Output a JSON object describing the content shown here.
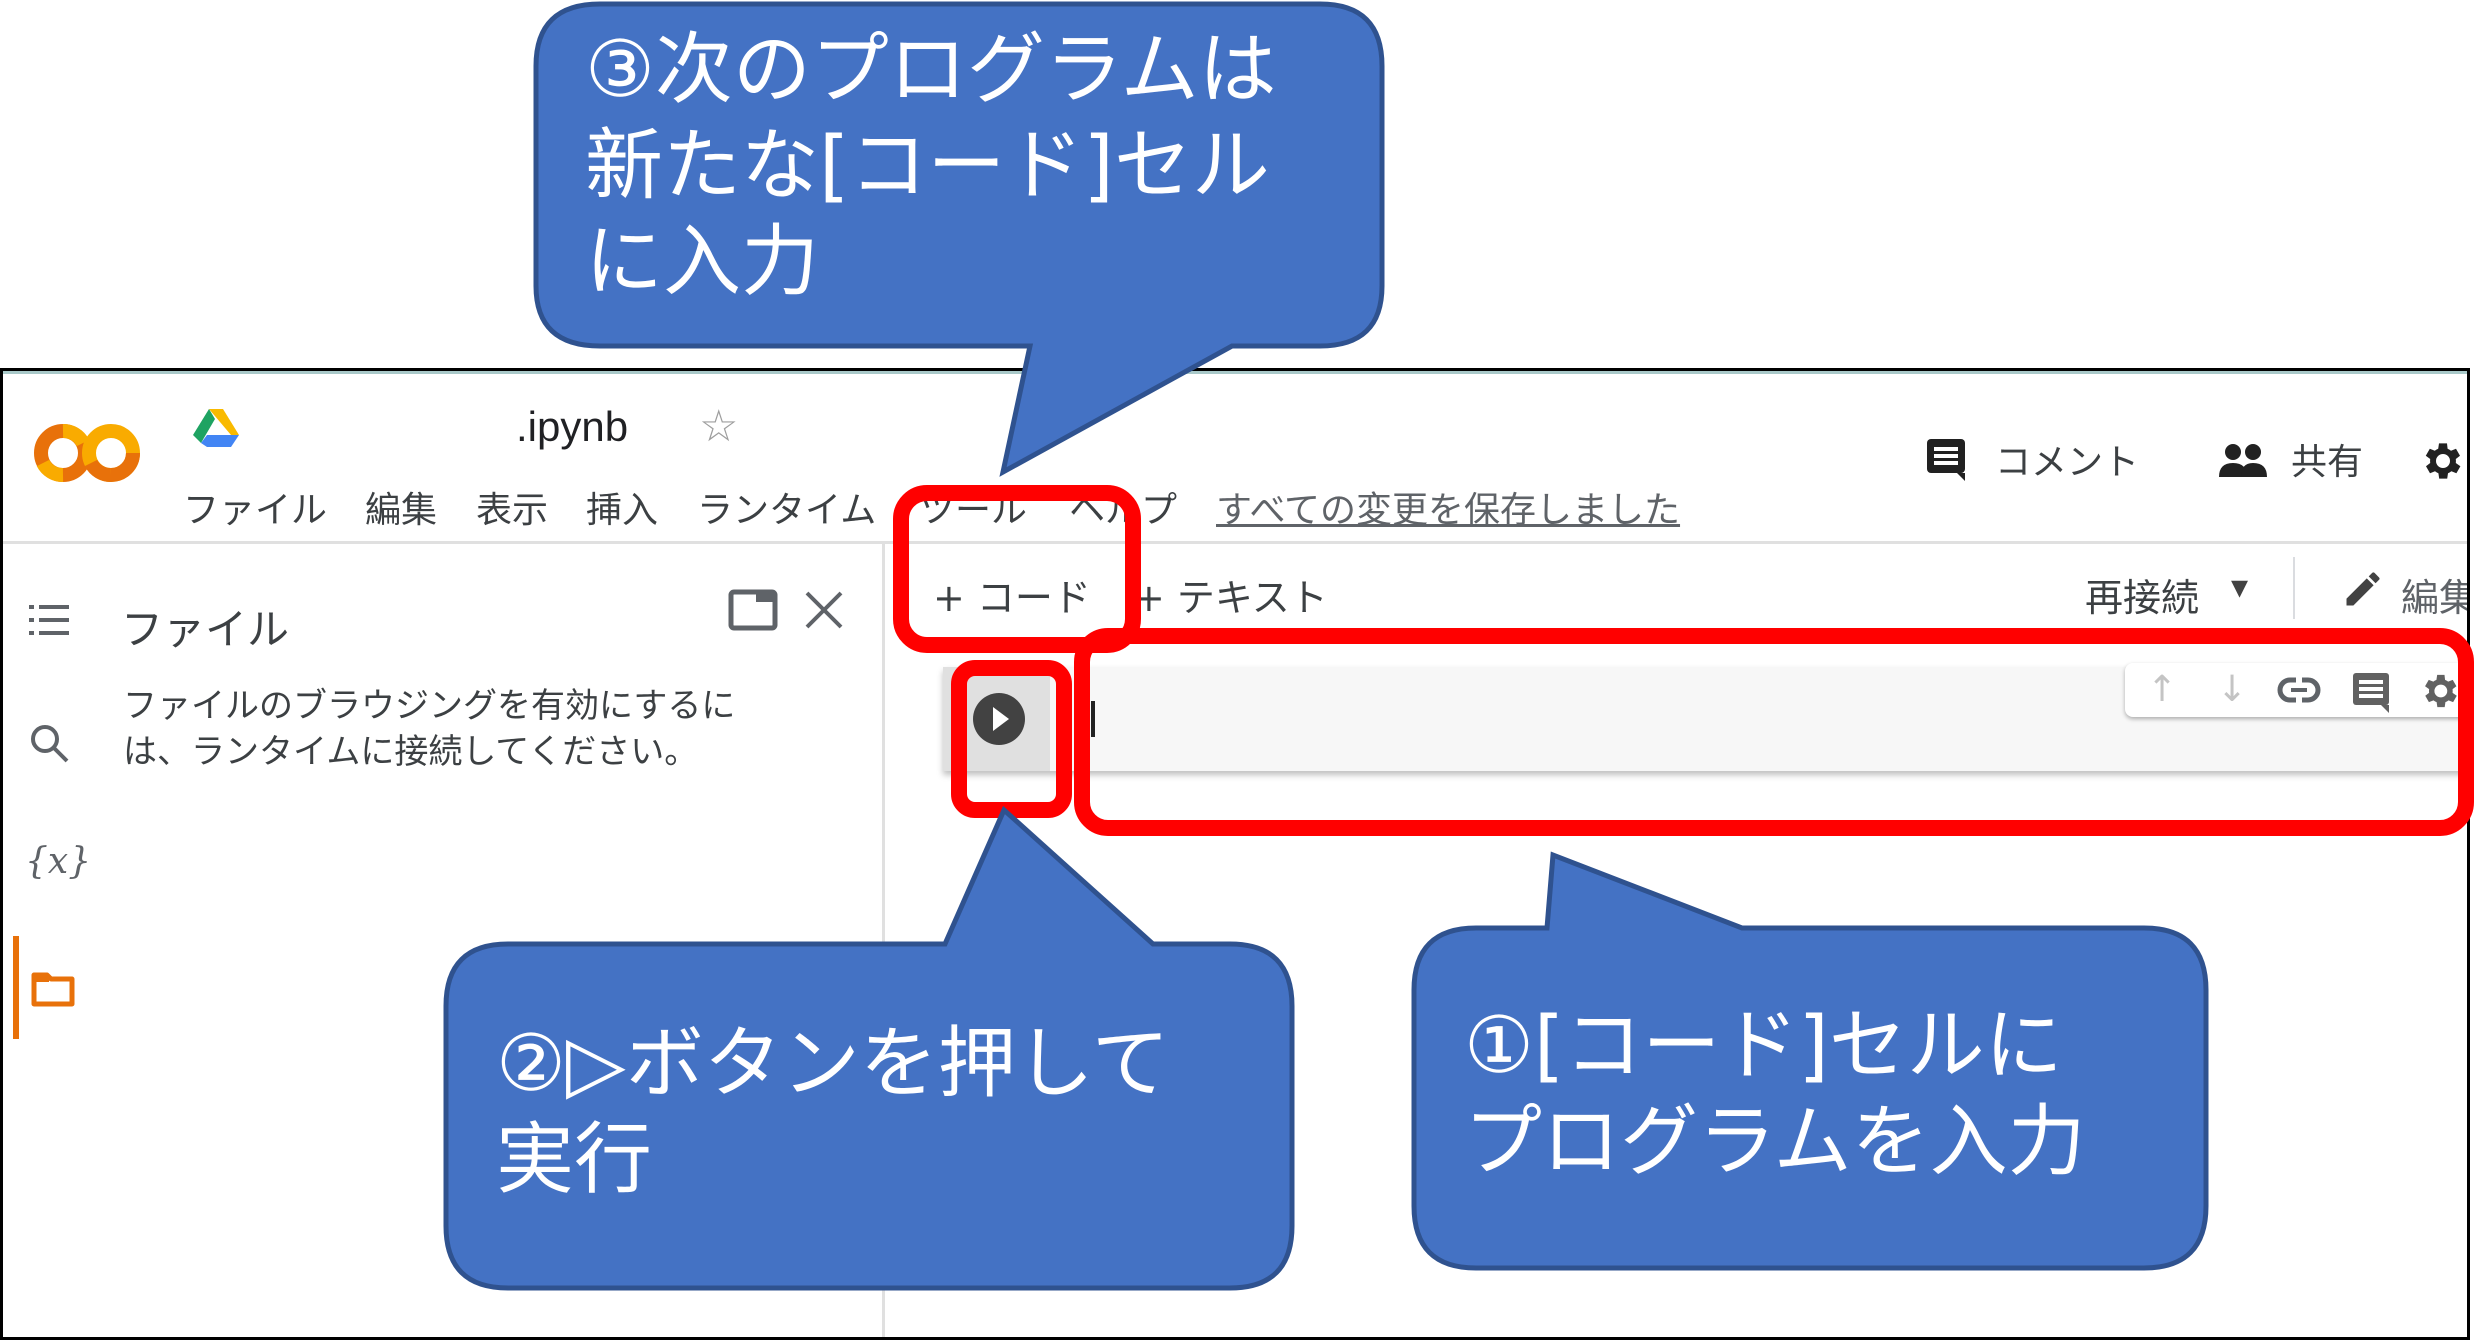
{
  "colors": {
    "bubble_fill": "#4472c4",
    "bubble_stroke": "#2f528f",
    "highlight_red": "#ff0000",
    "colab_orange": "#e8710a",
    "colab_yellow": "#f9ab00"
  },
  "header": {
    "notebook_title": ".ipynb",
    "star_icon": "☆",
    "menu": [
      "ファイル",
      "編集",
      "表示",
      "挿入",
      "ランタイム",
      "ツール",
      "ヘルプ"
    ],
    "save_status": "すべての変更を保存しました",
    "comment_label": "コメント",
    "share_label": "共有"
  },
  "sidebar": {
    "title": "ファイル",
    "description_line1": "ファイルのブラウジングを有効にするに",
    "description_line2": "は、ランタイムに接続してください。",
    "variables_icon": "{x}",
    "close_icon": "✕"
  },
  "toolbar": {
    "add_code": "+ コード",
    "add_text": "+ テキスト",
    "reconnect": "再接続",
    "dropdown_icon": "▾",
    "edit": "編集"
  },
  "cell_toolbar": {
    "up_icon": "↑",
    "down_icon": "↓"
  },
  "callouts": [
    {
      "step": 1,
      "line1": "①[コード]セルに",
      "line2": "プログラムを入力",
      "line3": ""
    },
    {
      "step": 2,
      "line1": "②▷ボタンを押して",
      "line2": "実行",
      "line3": ""
    },
    {
      "step": 3,
      "line1": "③次のプログラムは",
      "line2": "新たな[コード]セル",
      "line3": "に入力"
    }
  ]
}
